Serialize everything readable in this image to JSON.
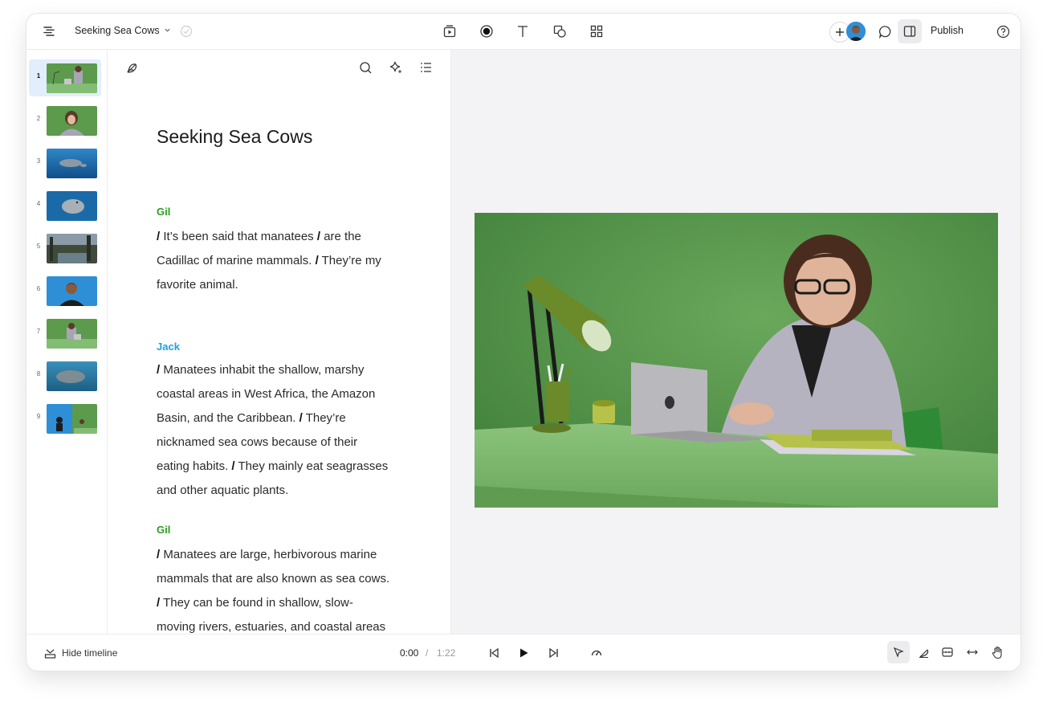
{
  "header": {
    "doc_title": "Seeking Sea Cows",
    "publish_label": "Publish"
  },
  "slides": [
    {
      "num": "1",
      "selected": true
    },
    {
      "num": "2"
    },
    {
      "num": "3"
    },
    {
      "num": "4"
    },
    {
      "num": "5"
    },
    {
      "num": "6"
    },
    {
      "num": "7"
    },
    {
      "num": "8"
    },
    {
      "num": "9"
    }
  ],
  "script": {
    "title": "Seeking Sea Cows",
    "blocks": [
      {
        "speaker": "Gil",
        "lines": [
          [
            [
              "/",
              " It’s been said that manatees "
            ],
            [
              "/",
              " are the"
            ]
          ],
          [
            [
              "",
              "Cadillac of marine mammals. "
            ],
            [
              "/",
              " They’re my"
            ]
          ],
          [
            [
              "",
              "favorite animal."
            ]
          ]
        ]
      },
      {
        "speaker": "Jack",
        "lines": [
          [
            [
              "/",
              " Manatees inhabit the shallow, marshy"
            ]
          ],
          [
            [
              "",
              "coastal areas in West Africa, the Amazon"
            ]
          ],
          [
            [
              "",
              "Basin, and the Caribbean. "
            ],
            [
              "/",
              " They’re"
            ]
          ],
          [
            [
              "",
              "nicknamed sea cows because of their"
            ]
          ],
          [
            [
              "",
              "eating habits. "
            ],
            [
              "/",
              " They mainly eat seagrasses"
            ]
          ],
          [
            [
              "",
              "and other aquatic plants."
            ]
          ]
        ]
      },
      {
        "speaker": "Gil",
        "lines": [
          [
            [
              "/",
              " Manatees are large, herbivorous marine"
            ]
          ],
          [
            [
              "",
              "mammals that are also known as sea cows."
            ]
          ],
          [
            [
              "/",
              " They can be found in shallow, slow-"
            ]
          ],
          [
            [
              "",
              "moving rivers, estuaries, and coastal areas"
            ]
          ]
        ]
      }
    ]
  },
  "footer": {
    "hide_timeline_label": "Hide timeline",
    "current_time": "0:00",
    "separator": "/",
    "total_time": "1:22"
  },
  "colors": {
    "speaker_gil": "#2a9d1e",
    "speaker_jack": "#1aa3e0",
    "selection": "#e3eefc"
  }
}
